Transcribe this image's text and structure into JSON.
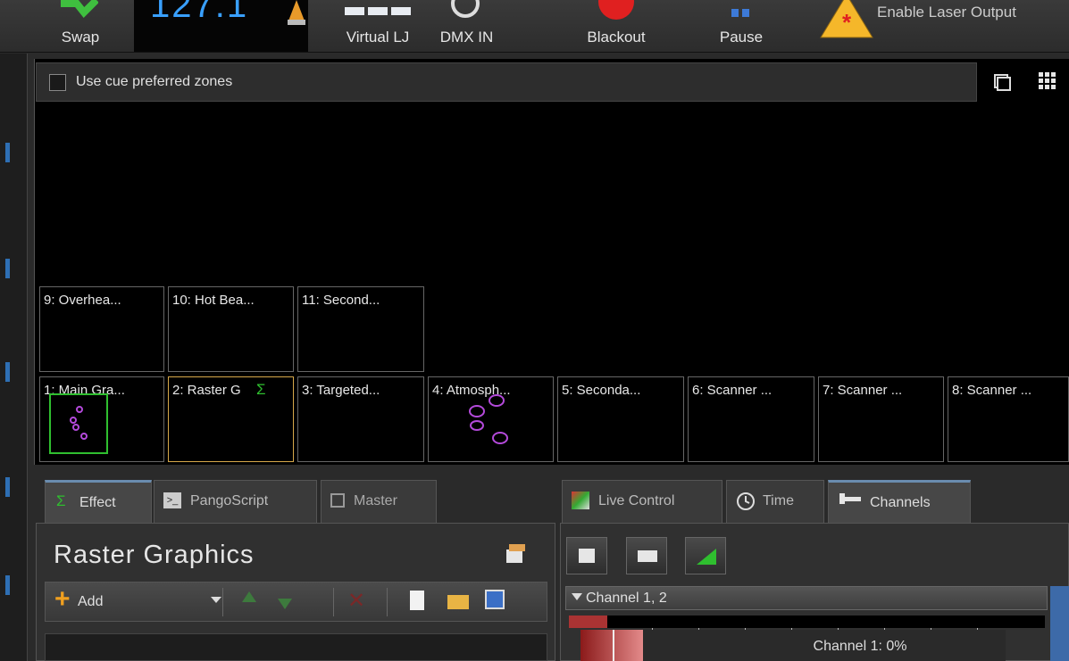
{
  "toolbar": {
    "swap_label": "Swap",
    "bpm_value": "127.1",
    "virtual_lj_label": "Virtual LJ",
    "dmx_in_label": "DMX IN",
    "blackout_label": "Blackout",
    "pause_label": "Pause",
    "enable_laser_label": "Enable Laser Output"
  },
  "zones": {
    "preferred_label": "Use cue preferred zones",
    "row_top": [
      {
        "label": "9: Overhea..."
      },
      {
        "label": "10: Hot Bea..."
      },
      {
        "label": "11: Second..."
      }
    ],
    "row_bottom": [
      {
        "label": "1: Main Gra..."
      },
      {
        "label": "2: Raster G"
      },
      {
        "label": "3: Targeted..."
      },
      {
        "label": "4: Atmosph..."
      },
      {
        "label": "5: Seconda..."
      },
      {
        "label": "6: Scanner ..."
      },
      {
        "label": "7: Scanner ..."
      },
      {
        "label": "8: Scanner ..."
      }
    ]
  },
  "left_tabs": {
    "effect": "Effect",
    "pangoscript": "PangoScript",
    "master": "Master"
  },
  "right_tabs": {
    "live_control": "Live Control",
    "time": "Time",
    "channels": "Channels"
  },
  "effect_panel": {
    "title": "Raster Graphics",
    "add_label": "Add"
  },
  "channels_panel": {
    "group_label": "Channel 1, 2",
    "channel_readout": "Channel 1: 0%"
  },
  "colors": {
    "accent_blue": "#39a0ff",
    "active_zone_border": "#d7a94a",
    "selected_zone_border": "#2fbf2f"
  }
}
